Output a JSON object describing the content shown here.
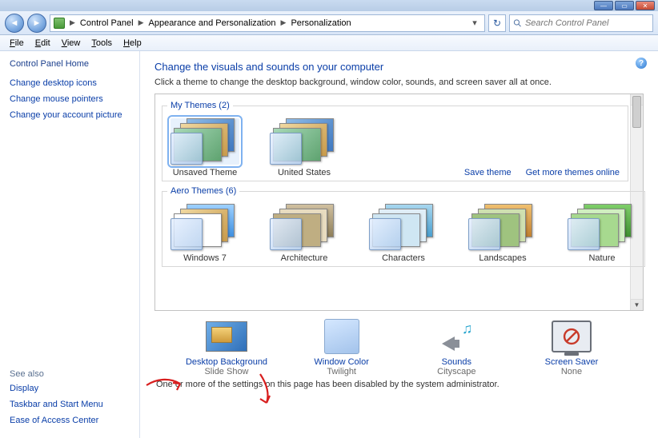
{
  "window": {
    "min": "—",
    "max": "▭",
    "close": "✕"
  },
  "address": {
    "crumbs": [
      "Control Panel",
      "Appearance and Personalization",
      "Personalization"
    ],
    "search_placeholder": "Search Control Panel"
  },
  "menu": {
    "file": "File",
    "edit": "Edit",
    "view": "View",
    "tools": "Tools",
    "help": "Help"
  },
  "sidebar": {
    "home": "Control Panel Home",
    "links": [
      "Change desktop icons",
      "Change mouse pointers",
      "Change your account picture"
    ],
    "see_also_label": "See also",
    "see_also": [
      "Display",
      "Taskbar and Start Menu",
      "Ease of Access Center"
    ]
  },
  "page": {
    "title": "Change the visuals and sounds on your computer",
    "subtitle": "Click a theme to change the desktop background, window color, sounds, and screen saver all at once.",
    "admin_note": "One or more of the settings on this page has been disabled by the system administrator."
  },
  "groups": {
    "my": {
      "legend": "My Themes (2)",
      "items": [
        "Unsaved Theme",
        "United States"
      ],
      "save": "Save theme",
      "more": "Get more themes online"
    },
    "aero": {
      "legend": "Aero Themes (6)",
      "items": [
        "Windows 7",
        "Architecture",
        "Characters",
        "Landscapes",
        "Nature"
      ]
    }
  },
  "settings": {
    "desktop_bg": {
      "label": "Desktop Background",
      "value": "Slide Show"
    },
    "window_color": {
      "label": "Window Color",
      "value": "Twilight"
    },
    "sounds": {
      "label": "Sounds",
      "value": "Cityscape"
    },
    "screen_saver": {
      "label": "Screen Saver",
      "value": "None"
    }
  }
}
